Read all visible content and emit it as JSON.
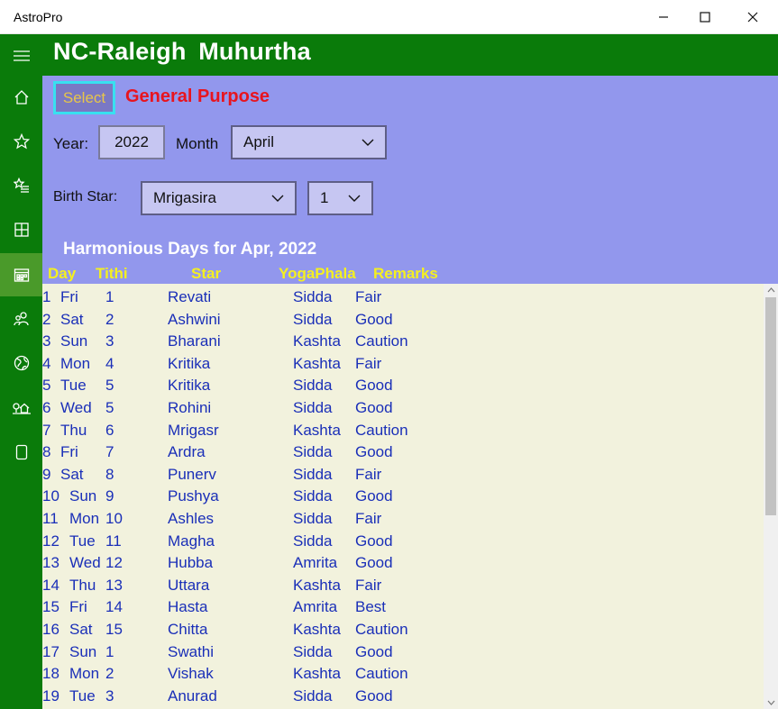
{
  "window": {
    "title": "AstroPro"
  },
  "header": {
    "title": "NC-Raleigh Muhurtha"
  },
  "panel": {
    "select_label": "Select",
    "purpose": "General Purpose",
    "year_label": "Year:",
    "year_value": "2022",
    "month_label": "Month",
    "month_value": "April",
    "birthstar_label": "Birth Star:",
    "star_value": "Mrigasira",
    "pada_value": "1",
    "list_title": "Harmonious Days for Apr, 2022"
  },
  "columns": {
    "day": "Day",
    "tithi": "Tithi",
    "star": "Star",
    "yoga": "YogaPhala",
    "remarks": "Remarks"
  },
  "rows": [
    {
      "day": "1",
      "dow": "Fri",
      "tithi": "1",
      "star": "Revati",
      "yoga": "Sidda",
      "remark": "Fair"
    },
    {
      "day": "2",
      "dow": "Sat",
      "tithi": "2",
      "star": "Ashwini",
      "yoga": "Sidda",
      "remark": "Good"
    },
    {
      "day": "3",
      "dow": "Sun",
      "tithi": "3",
      "star": "Bharani",
      "yoga": "Kashta",
      "remark": "Caution"
    },
    {
      "day": "4",
      "dow": "Mon",
      "tithi": "4",
      "star": "Kritika",
      "yoga": "Kashta",
      "remark": "Fair"
    },
    {
      "day": "5",
      "dow": "Tue",
      "tithi": "5",
      "star": "Kritika",
      "yoga": "Sidda",
      "remark": "Good"
    },
    {
      "day": "6",
      "dow": "Wed",
      "tithi": "5",
      "star": "Rohini",
      "yoga": "Sidda",
      "remark": "Good"
    },
    {
      "day": "7",
      "dow": "Thu",
      "tithi": "6",
      "star": "Mrigasr",
      "yoga": "Kashta",
      "remark": "Caution"
    },
    {
      "day": "8",
      "dow": "Fri",
      "tithi": "7",
      "star": "Ardra",
      "yoga": "Sidda",
      "remark": "Good"
    },
    {
      "day": "9",
      "dow": "Sat",
      "tithi": "8",
      "star": "Punerv",
      "yoga": "Sidda",
      "remark": "Fair"
    },
    {
      "day": "10",
      "dow": "Sun",
      "tithi": "9",
      "star": "Pushya",
      "yoga": "Sidda",
      "remark": "Good"
    },
    {
      "day": "11",
      "dow": "Mon",
      "tithi": "10",
      "star": "Ashles",
      "yoga": "Sidda",
      "remark": "Fair"
    },
    {
      "day": "12",
      "dow": "Tue",
      "tithi": "11",
      "star": "Magha",
      "yoga": "Sidda",
      "remark": "Good"
    },
    {
      "day": "13",
      "dow": "Wed",
      "tithi": "12",
      "star": "Hubba",
      "yoga": "Amrita",
      "remark": "Good"
    },
    {
      "day": "14",
      "dow": "Thu",
      "tithi": "13",
      "star": "Uttara",
      "yoga": "Kashta",
      "remark": "Fair"
    },
    {
      "day": "15",
      "dow": "Fri",
      "tithi": "14",
      "star": "Hasta",
      "yoga": "Amrita",
      "remark": "Best"
    },
    {
      "day": "16",
      "dow": "Sat",
      "tithi": "15",
      "star": "Chitta",
      "yoga": "Kashta",
      "remark": "Caution"
    },
    {
      "day": "17",
      "dow": "Sun",
      "tithi": "1",
      "star": "Swathi",
      "yoga": "Sidda",
      "remark": "Good"
    },
    {
      "day": "18",
      "dow": "Mon",
      "tithi": "2",
      "star": "Vishak",
      "yoga": "Kashta",
      "remark": "Caution"
    },
    {
      "day": "19",
      "dow": "Tue",
      "tithi": "3",
      "star": "Anurad",
      "yoga": "Sidda",
      "remark": "Good"
    }
  ],
  "nav_icons": [
    "menu-icon",
    "home-icon",
    "star-icon",
    "starred-list-icon",
    "grid-icon",
    "calendar-icon",
    "people-icon",
    "globe-icon",
    "house-tree-icon",
    "tablet-icon"
  ]
}
